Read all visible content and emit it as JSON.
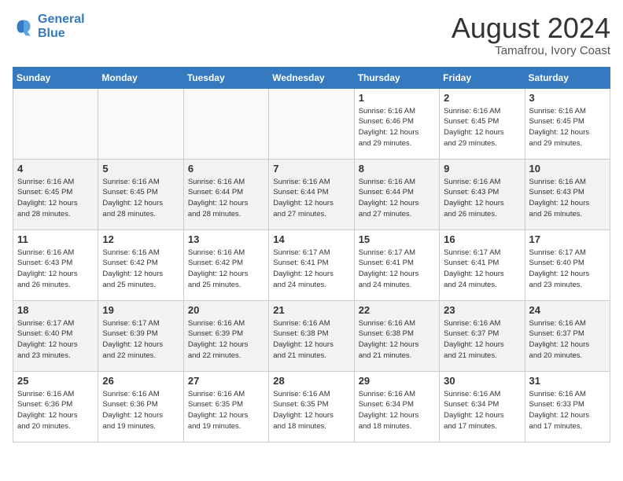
{
  "header": {
    "logo_line1": "General",
    "logo_line2": "Blue",
    "month_year": "August 2024",
    "location": "Tamafrou, Ivory Coast"
  },
  "days_of_week": [
    "Sunday",
    "Monday",
    "Tuesday",
    "Wednesday",
    "Thursday",
    "Friday",
    "Saturday"
  ],
  "weeks": [
    [
      {
        "day": "",
        "info": ""
      },
      {
        "day": "",
        "info": ""
      },
      {
        "day": "",
        "info": ""
      },
      {
        "day": "",
        "info": ""
      },
      {
        "day": "1",
        "info": "Sunrise: 6:16 AM\nSunset: 6:46 PM\nDaylight: 12 hours\nand 29 minutes."
      },
      {
        "day": "2",
        "info": "Sunrise: 6:16 AM\nSunset: 6:45 PM\nDaylight: 12 hours\nand 29 minutes."
      },
      {
        "day": "3",
        "info": "Sunrise: 6:16 AM\nSunset: 6:45 PM\nDaylight: 12 hours\nand 29 minutes."
      }
    ],
    [
      {
        "day": "4",
        "info": "Sunrise: 6:16 AM\nSunset: 6:45 PM\nDaylight: 12 hours\nand 28 minutes."
      },
      {
        "day": "5",
        "info": "Sunrise: 6:16 AM\nSunset: 6:45 PM\nDaylight: 12 hours\nand 28 minutes."
      },
      {
        "day": "6",
        "info": "Sunrise: 6:16 AM\nSunset: 6:44 PM\nDaylight: 12 hours\nand 28 minutes."
      },
      {
        "day": "7",
        "info": "Sunrise: 6:16 AM\nSunset: 6:44 PM\nDaylight: 12 hours\nand 27 minutes."
      },
      {
        "day": "8",
        "info": "Sunrise: 6:16 AM\nSunset: 6:44 PM\nDaylight: 12 hours\nand 27 minutes."
      },
      {
        "day": "9",
        "info": "Sunrise: 6:16 AM\nSunset: 6:43 PM\nDaylight: 12 hours\nand 26 minutes."
      },
      {
        "day": "10",
        "info": "Sunrise: 6:16 AM\nSunset: 6:43 PM\nDaylight: 12 hours\nand 26 minutes."
      }
    ],
    [
      {
        "day": "11",
        "info": "Sunrise: 6:16 AM\nSunset: 6:43 PM\nDaylight: 12 hours\nand 26 minutes."
      },
      {
        "day": "12",
        "info": "Sunrise: 6:16 AM\nSunset: 6:42 PM\nDaylight: 12 hours\nand 25 minutes."
      },
      {
        "day": "13",
        "info": "Sunrise: 6:16 AM\nSunset: 6:42 PM\nDaylight: 12 hours\nand 25 minutes."
      },
      {
        "day": "14",
        "info": "Sunrise: 6:17 AM\nSunset: 6:41 PM\nDaylight: 12 hours\nand 24 minutes."
      },
      {
        "day": "15",
        "info": "Sunrise: 6:17 AM\nSunset: 6:41 PM\nDaylight: 12 hours\nand 24 minutes."
      },
      {
        "day": "16",
        "info": "Sunrise: 6:17 AM\nSunset: 6:41 PM\nDaylight: 12 hours\nand 24 minutes."
      },
      {
        "day": "17",
        "info": "Sunrise: 6:17 AM\nSunset: 6:40 PM\nDaylight: 12 hours\nand 23 minutes."
      }
    ],
    [
      {
        "day": "18",
        "info": "Sunrise: 6:17 AM\nSunset: 6:40 PM\nDaylight: 12 hours\nand 23 minutes."
      },
      {
        "day": "19",
        "info": "Sunrise: 6:17 AM\nSunset: 6:39 PM\nDaylight: 12 hours\nand 22 minutes."
      },
      {
        "day": "20",
        "info": "Sunrise: 6:16 AM\nSunset: 6:39 PM\nDaylight: 12 hours\nand 22 minutes."
      },
      {
        "day": "21",
        "info": "Sunrise: 6:16 AM\nSunset: 6:38 PM\nDaylight: 12 hours\nand 21 minutes."
      },
      {
        "day": "22",
        "info": "Sunrise: 6:16 AM\nSunset: 6:38 PM\nDaylight: 12 hours\nand 21 minutes."
      },
      {
        "day": "23",
        "info": "Sunrise: 6:16 AM\nSunset: 6:37 PM\nDaylight: 12 hours\nand 21 minutes."
      },
      {
        "day": "24",
        "info": "Sunrise: 6:16 AM\nSunset: 6:37 PM\nDaylight: 12 hours\nand 20 minutes."
      }
    ],
    [
      {
        "day": "25",
        "info": "Sunrise: 6:16 AM\nSunset: 6:36 PM\nDaylight: 12 hours\nand 20 minutes."
      },
      {
        "day": "26",
        "info": "Sunrise: 6:16 AM\nSunset: 6:36 PM\nDaylight: 12 hours\nand 19 minutes."
      },
      {
        "day": "27",
        "info": "Sunrise: 6:16 AM\nSunset: 6:35 PM\nDaylight: 12 hours\nand 19 minutes."
      },
      {
        "day": "28",
        "info": "Sunrise: 6:16 AM\nSunset: 6:35 PM\nDaylight: 12 hours\nand 18 minutes."
      },
      {
        "day": "29",
        "info": "Sunrise: 6:16 AM\nSunset: 6:34 PM\nDaylight: 12 hours\nand 18 minutes."
      },
      {
        "day": "30",
        "info": "Sunrise: 6:16 AM\nSunset: 6:34 PM\nDaylight: 12 hours\nand 17 minutes."
      },
      {
        "day": "31",
        "info": "Sunrise: 6:16 AM\nSunset: 6:33 PM\nDaylight: 12 hours\nand 17 minutes."
      }
    ]
  ]
}
